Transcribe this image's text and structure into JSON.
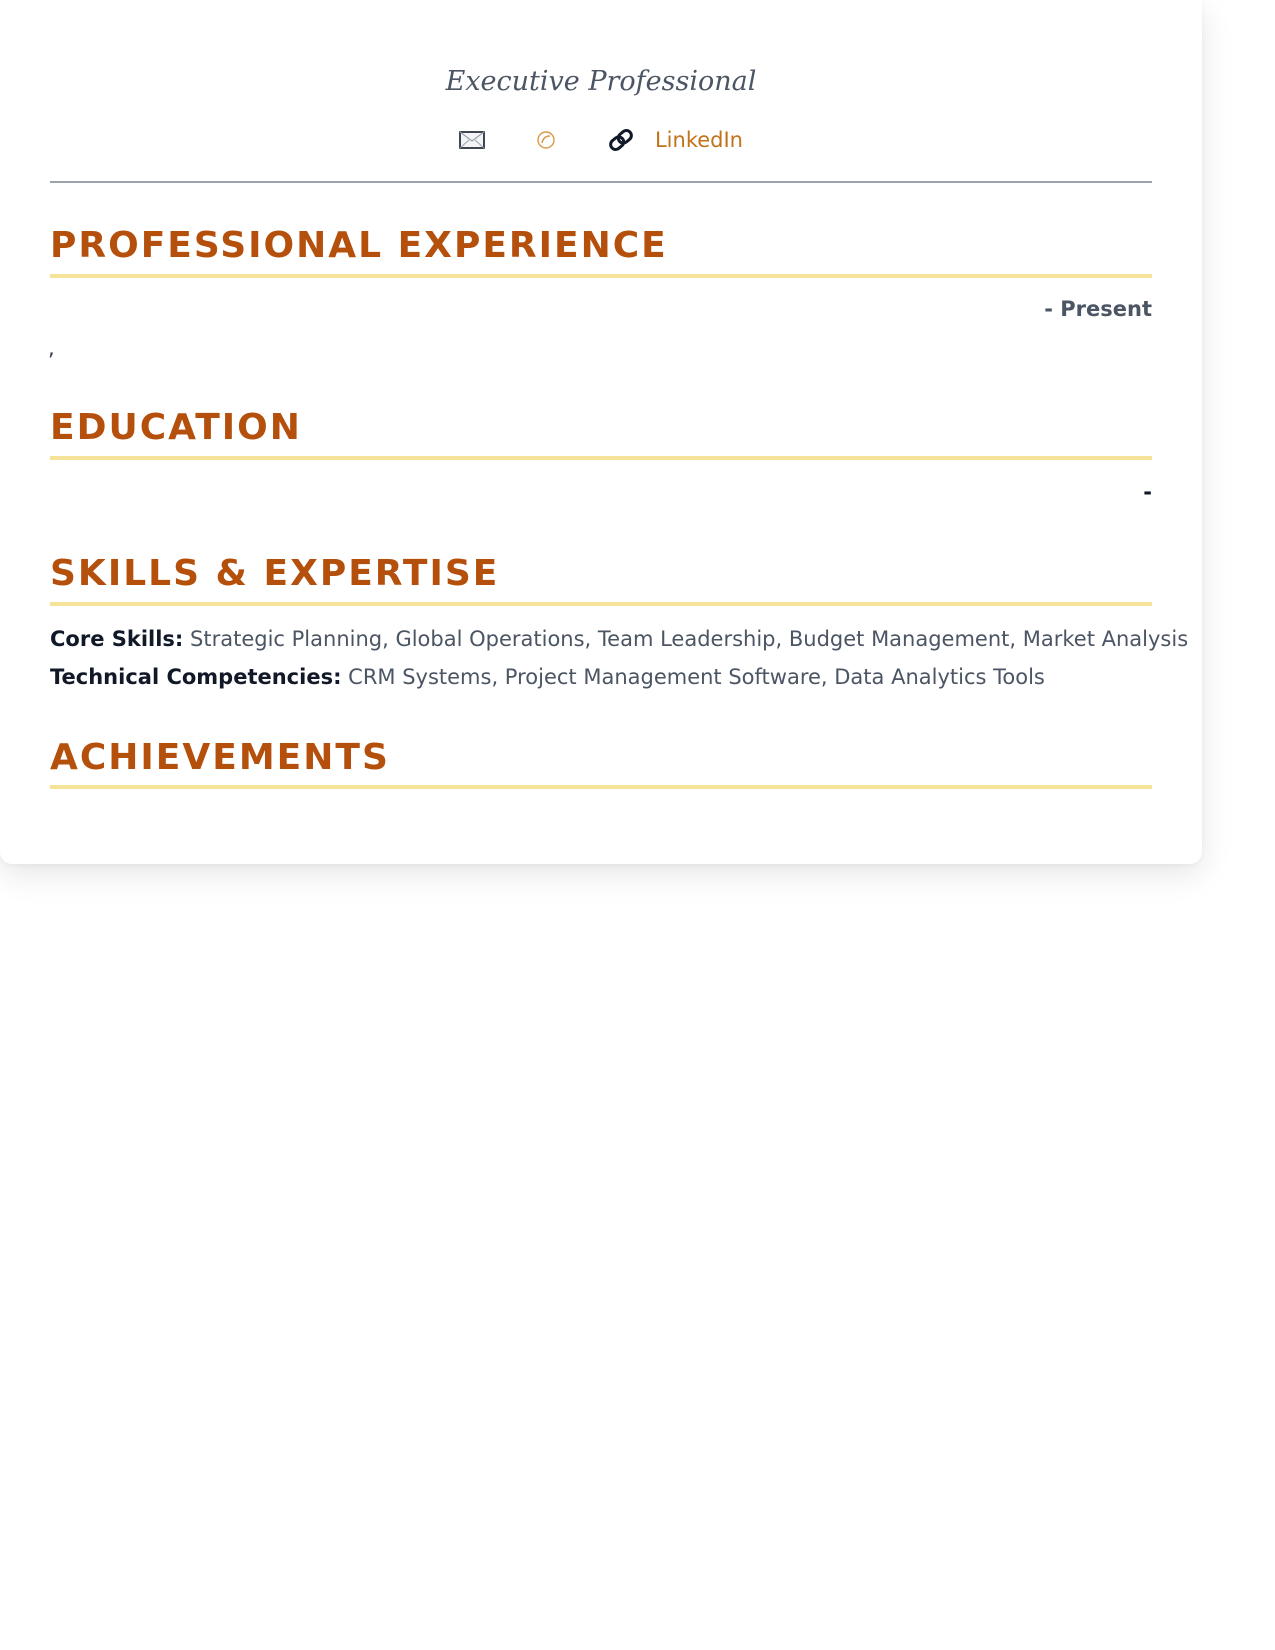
{
  "header": {
    "tagline": "Executive Professional",
    "contacts": {
      "email_icon": "envelope-icon",
      "phone_icon": "phone-icon",
      "link_icon": "link-icon",
      "linkedin_label": "LinkedIn"
    }
  },
  "sections": {
    "experience": {
      "title": "PROFESSIONAL EXPERIENCE",
      "date_range": "- Present",
      "location": ","
    },
    "education": {
      "title": "EDUCATION",
      "date_range": "-"
    },
    "skills": {
      "title": "SKILLS & EXPERTISE",
      "core_label": "Core Skills:",
      "core_value": "Strategic Planning, Global Operations, Team Leadership, Budget Management, Market Analysis",
      "tech_label": "Technical Competencies:",
      "tech_value": "CRM Systems, Project Management Software, Data Analytics Tools"
    },
    "achievements": {
      "title": "ACHIEVEMENTS"
    }
  },
  "colors": {
    "heading": "#b4500c",
    "accent_rule": "#f6e39a",
    "link": "#c2721a"
  }
}
